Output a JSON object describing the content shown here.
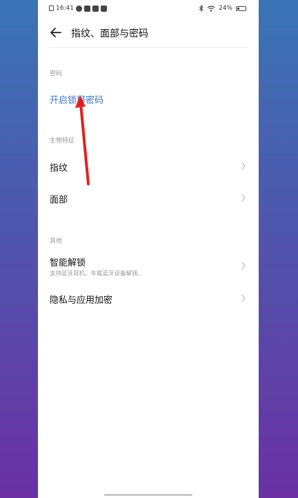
{
  "status": {
    "time": "16:41",
    "battery": "24%"
  },
  "header": {
    "title": "指纹、面部与密码"
  },
  "sections": {
    "password": "密码",
    "biometrics": "生物特征",
    "others": "其他"
  },
  "items": {
    "lock_password": "开启锁屏密码",
    "fingerprint": "指纹",
    "face": "面部",
    "smart_unlock": "智能解锁",
    "smart_unlock_sub": "支持蓝牙耳机、车载蓝牙设备解锁。",
    "privacy_encrypt": "隐私与应用加密"
  },
  "colors": {
    "accent": "#3f75b8",
    "arrow": "#e02020",
    "background_gradient": [
      "#3a74b6",
      "#6a31a3"
    ]
  },
  "icons": [
    "back-arrow-icon",
    "chevron-right-icon",
    "wifi-icon",
    "bluetooth-icon",
    "battery-icon"
  ]
}
